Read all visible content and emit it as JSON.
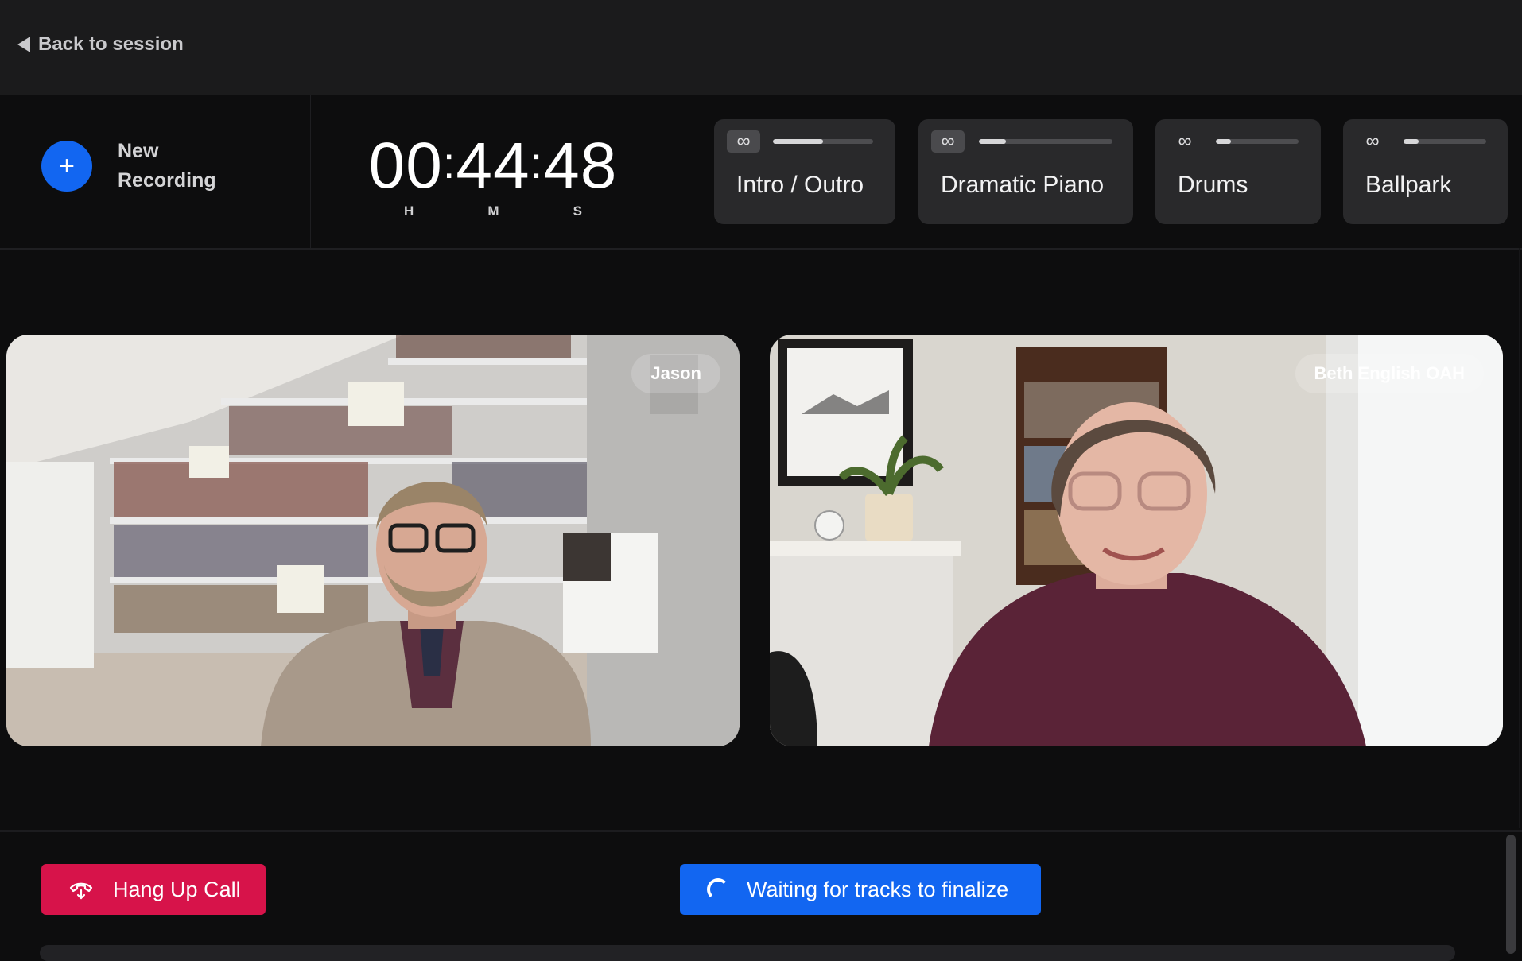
{
  "header": {
    "back_label": "Back to session",
    "back_icon": "caret-left-icon"
  },
  "controls": {
    "new_recording_label": "New Recording",
    "new_recording_icon": "plus-icon",
    "timer": {
      "hours": "00",
      "minutes": "44",
      "seconds": "48",
      "unit_h": "H",
      "unit_m": "M",
      "unit_s": "S"
    },
    "sounds": [
      {
        "name": "Intro / Outro",
        "progress": 0.5,
        "loop_active": true
      },
      {
        "name": "Dramatic Piano",
        "progress": 0.2,
        "loop_active": true
      },
      {
        "name": "Drums",
        "progress": 0.18,
        "loop_active": false
      },
      {
        "name": "Ballpark",
        "progress": 0.18,
        "loop_active": false
      }
    ]
  },
  "participants": [
    {
      "name": "Jason"
    },
    {
      "name": "Beth English OAH"
    }
  ],
  "footer": {
    "hangup_label": "Hang Up Call",
    "hangup_icon": "phone-hangup-icon",
    "status_label": "Waiting for tracks to finalize",
    "status_icon": "spinner-icon"
  },
  "colors": {
    "accent_blue": "#1266f1",
    "danger_red": "#d7134a",
    "background": "#0d0d0e",
    "card": "#29292b"
  }
}
